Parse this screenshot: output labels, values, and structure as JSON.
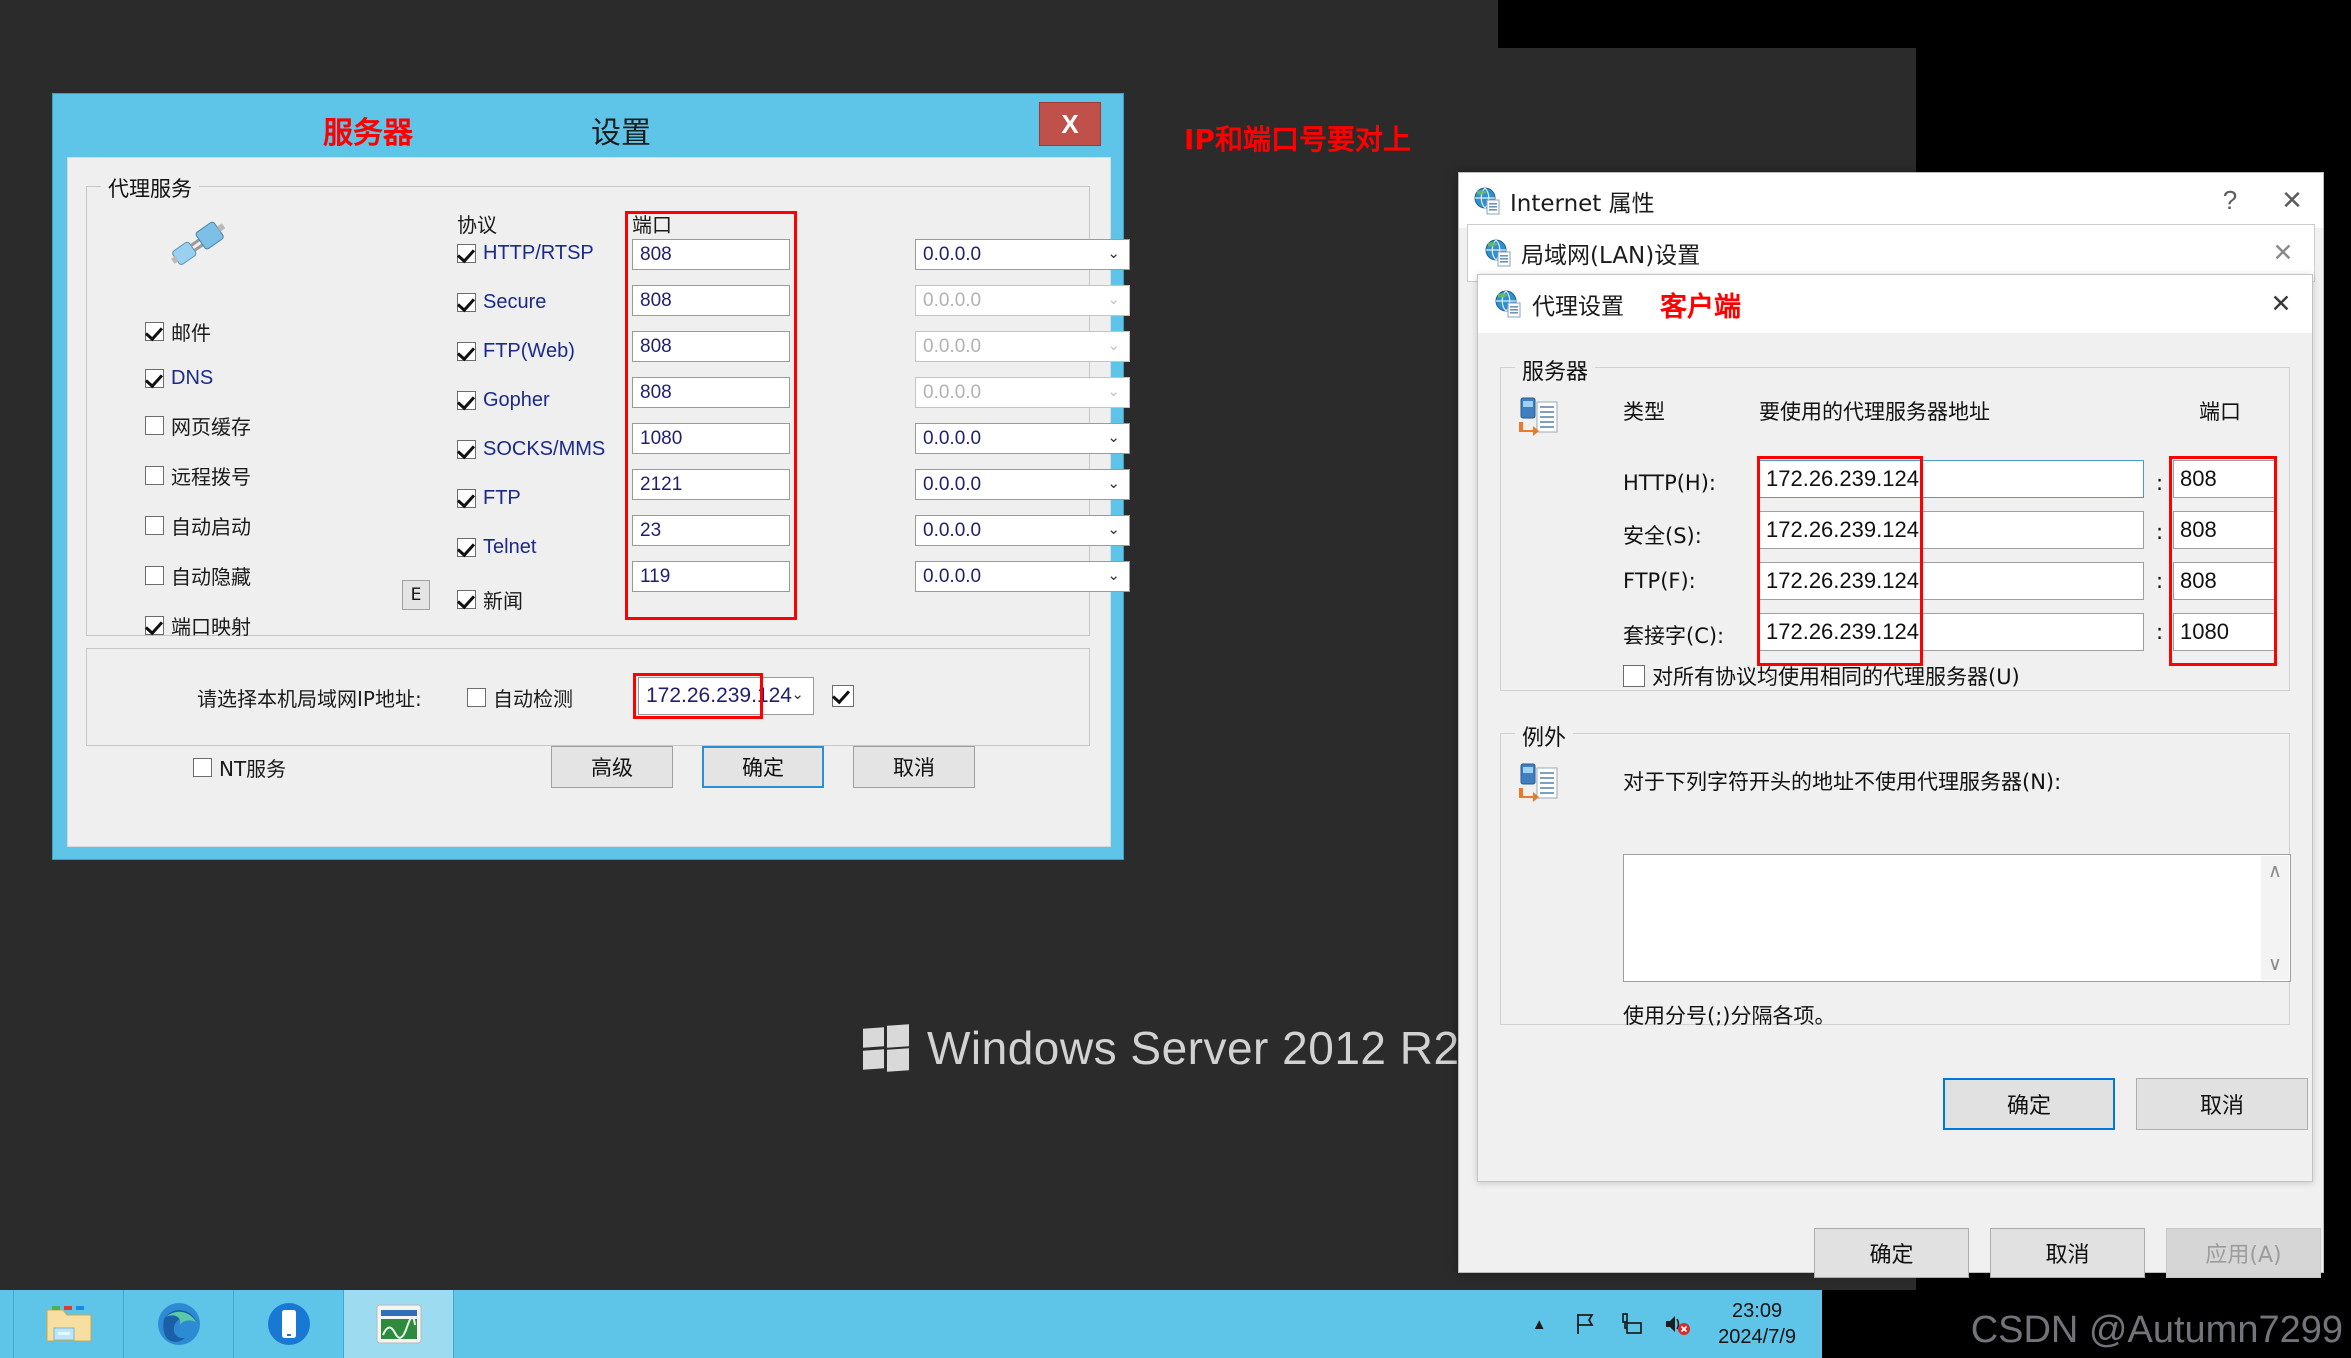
{
  "desktop": {
    "watermark": "Windows Server 2012 R2",
    "annotation_top": "IP和端口号要对上",
    "csdn": "CSDN @Autumn7299"
  },
  "taskbar": {
    "items": [
      {
        "name": "file-explorer",
        "icon": "folder-icon"
      },
      {
        "name": "edge-browser",
        "icon": "edge-icon"
      },
      {
        "name": "store-app",
        "icon": "phone-icon"
      },
      {
        "name": "task-manager",
        "icon": "chart-window-icon"
      }
    ],
    "tray": {
      "show_hidden": "▲",
      "icons": [
        "flag-icon",
        "network-icon",
        "volume-muted-icon"
      ],
      "time": "23:09",
      "date": "2024/7/9"
    }
  },
  "left_dialog": {
    "title_red": "服务器",
    "title_main": "设置",
    "close_label": "X",
    "group_title": "代理服务",
    "icon": "plug-connector-icon",
    "left_options": [
      {
        "label": "邮件",
        "checked": true
      },
      {
        "label": "DNS",
        "checked": true
      },
      {
        "label": "网页缓存",
        "checked": false
      },
      {
        "label": "远程拨号",
        "checked": false
      },
      {
        "label": "自动启动",
        "checked": false
      },
      {
        "label": "自动隐藏",
        "checked": false
      },
      {
        "label": "端口映射",
        "checked": true
      }
    ],
    "e_button": "E",
    "col_protocol": "协议",
    "col_port": "端口",
    "protocols": [
      {
        "label": "HTTP/RTSP",
        "checked": true,
        "port": "808",
        "ip": "0.0.0.0",
        "ip_disabled": false
      },
      {
        "label": "Secure",
        "checked": true,
        "port": "808",
        "ip": "0.0.0.0",
        "ip_disabled": true
      },
      {
        "label": "FTP(Web)",
        "checked": true,
        "port": "808",
        "ip": "0.0.0.0",
        "ip_disabled": true
      },
      {
        "label": "Gopher",
        "checked": true,
        "port": "808",
        "ip": "0.0.0.0",
        "ip_disabled": true
      },
      {
        "label": "SOCKS/MMS",
        "checked": true,
        "port": "1080",
        "ip": "0.0.0.0",
        "ip_disabled": false
      },
      {
        "label": "FTP",
        "checked": true,
        "port": "2121",
        "ip": "0.0.0.0",
        "ip_disabled": false
      },
      {
        "label": "Telnet",
        "checked": true,
        "port": "23",
        "ip": "0.0.0.0",
        "ip_disabled": false
      },
      {
        "label": "新闻",
        "checked": true,
        "port": "119",
        "ip": "0.0.0.0",
        "ip_disabled": false
      }
    ],
    "ip_row": {
      "label": "请选择本机局域网IP地址:",
      "auto_detect_label": "自动检测",
      "auto_detect_checked": false,
      "ip_value": "172.26.239.124",
      "trailing_checked": true
    },
    "nt_service": {
      "label": "NT服务",
      "checked": false
    },
    "buttons": {
      "advanced": "高级",
      "ok": "确定",
      "cancel": "取消"
    }
  },
  "ie_properties": {
    "title": "Internet 属性",
    "help_label": "?",
    "close_label": "✕",
    "lan_window_title": "局域网(LAN)设置",
    "lan_close_label": "✕",
    "proxy_window_title": "代理设置",
    "proxy_annotation": "客户端",
    "proxy_close_label": "✕",
    "servers_group": "服务器",
    "headers": {
      "type": "类型",
      "address": "要使用的代理服务器地址",
      "port": "端口"
    },
    "rows": [
      {
        "type": "HTTP(H):",
        "address": "172.26.239.124",
        "port": "808",
        "focused": true
      },
      {
        "type": "安全(S):",
        "address": "172.26.239.124",
        "port": "808",
        "focused": false
      },
      {
        "type": "FTP(F):",
        "address": "172.26.239.124",
        "port": "808",
        "focused": false
      },
      {
        "type": "套接字(C):",
        "address": "172.26.239.124",
        "port": "1080",
        "focused": false
      }
    ],
    "same_proxy": {
      "label": "对所有协议均使用相同的代理服务器(U)",
      "checked": false
    },
    "exceptions_group": "例外",
    "exceptions_label": "对于下列字符开头的地址不使用代理服务器(N):",
    "exceptions_value": "",
    "exceptions_hint": "使用分号(;)分隔各项。",
    "dialog_buttons": {
      "ok": "确定",
      "cancel": "取消"
    },
    "outer_buttons": {
      "ok": "确定",
      "cancel": "取消",
      "apply": "应用(A)"
    }
  }
}
